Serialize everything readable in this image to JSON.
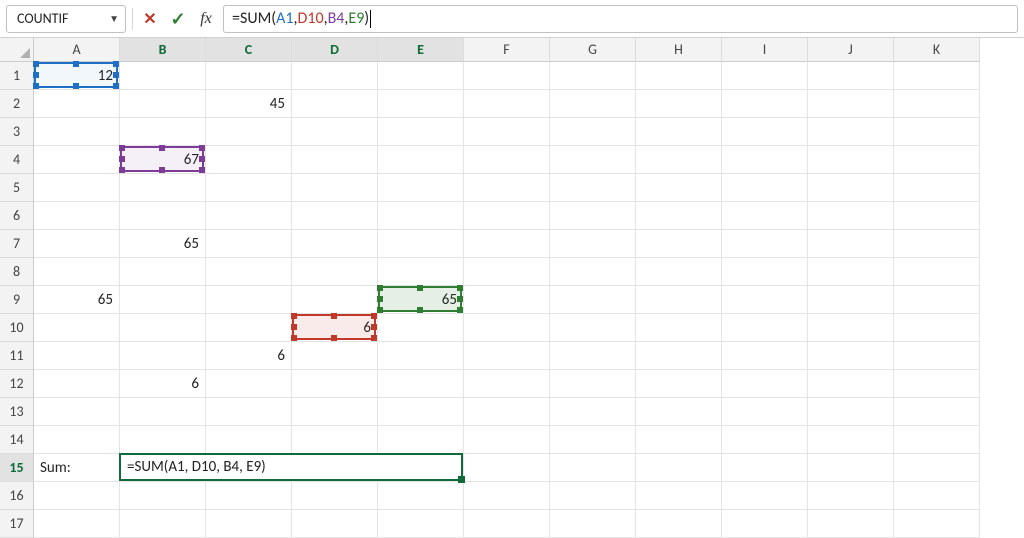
{
  "formula_bar": {
    "name_box": "COUNTIF",
    "cancel_label": "✕",
    "accept_label": "✓",
    "fx_label": "fx",
    "formula_prefix": "=SUM(",
    "ref_a1": "A1",
    "ref_d10": "D10",
    "ref_b4": "B4",
    "ref_e9": "E9",
    "sep": ", ",
    "formula_suffix": ")"
  },
  "columns": [
    "A",
    "B",
    "C",
    "D",
    "E",
    "F",
    "G",
    "H",
    "I",
    "J",
    "K"
  ],
  "row_count": 17,
  "highlighted_columns": [
    "B",
    "C",
    "D",
    "E"
  ],
  "highlighted_row": 15,
  "cells": {
    "A1": "12",
    "C2": "45",
    "B4": "67",
    "B7": "65",
    "A9": "65",
    "E9": "65",
    "D10": "6",
    "C11": "6",
    "B12": "6",
    "A15": "Sum:"
  },
  "edit_cell": {
    "address": "B15",
    "display": "=SUM(A1, D10, B4, E9)",
    "span_cols": 4
  },
  "ref_highlights": [
    {
      "ref": "A1",
      "color": "blue"
    },
    {
      "ref": "B4",
      "color": "purple"
    },
    {
      "ref": "E9",
      "color": "green"
    },
    {
      "ref": "D10",
      "color": "red"
    }
  ],
  "chart_data": {
    "type": "table",
    "title": "Spreadsheet cell values",
    "columns": [
      "A",
      "B",
      "C",
      "D",
      "E"
    ],
    "rows": 17,
    "data": [
      {
        "cell": "A1",
        "value": 12
      },
      {
        "cell": "C2",
        "value": 45
      },
      {
        "cell": "B4",
        "value": 67
      },
      {
        "cell": "B7",
        "value": 65
      },
      {
        "cell": "A9",
        "value": 65
      },
      {
        "cell": "E9",
        "value": 65
      },
      {
        "cell": "D10",
        "value": 6
      },
      {
        "cell": "C11",
        "value": 6
      },
      {
        "cell": "B12",
        "value": 6
      },
      {
        "cell": "A15",
        "value": "Sum:"
      },
      {
        "cell": "B15",
        "value": "=SUM(A1, D10, B4, E9)"
      }
    ]
  }
}
